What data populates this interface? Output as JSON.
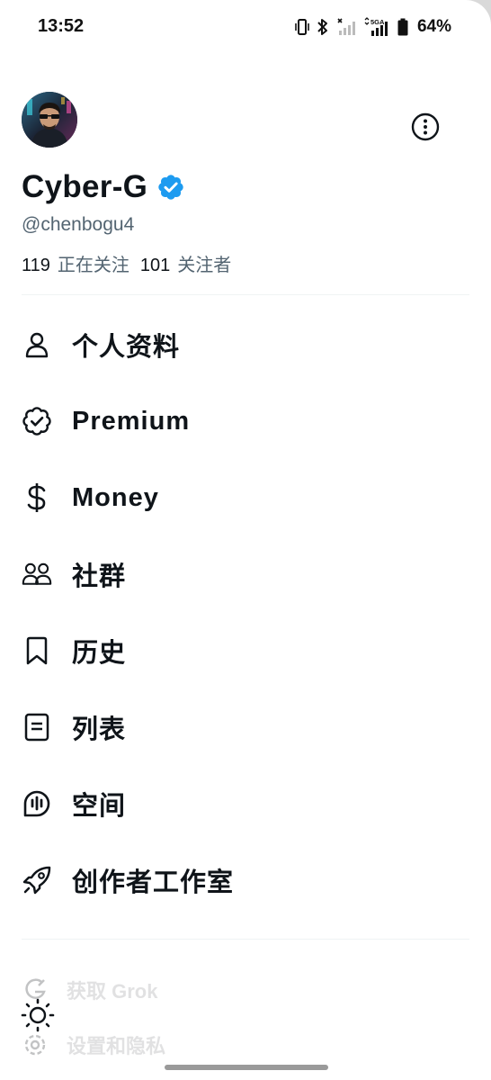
{
  "status_bar": {
    "time": "13:52",
    "battery": "64%",
    "network_label": "5GA"
  },
  "profile": {
    "display_name": "Cyber-G",
    "handle": "@chenbogu4",
    "following_count": "119",
    "following_label": "正在关注",
    "followers_count": "101",
    "followers_label": "关注者",
    "verified_color": "#1d9bf0"
  },
  "menu": {
    "items": [
      {
        "label": "个人资料",
        "icon": "person-icon"
      },
      {
        "label": "Premium",
        "icon": "verified-badge-icon"
      },
      {
        "label": "Money",
        "icon": "dollar-icon"
      },
      {
        "label": "社群",
        "icon": "communities-icon"
      },
      {
        "label": "历史",
        "icon": "bookmark-icon"
      },
      {
        "label": "列表",
        "icon": "lists-icon"
      },
      {
        "label": "空间",
        "icon": "spaces-icon"
      },
      {
        "label": "创作者工作室",
        "icon": "rocket-icon"
      }
    ]
  },
  "secondary": {
    "grok_label": "获取 Grok",
    "settings_label": "设置和隐私"
  },
  "colors": {
    "text_primary": "#0f1419",
    "text_secondary": "#536471",
    "accent": "#1d9bf0"
  }
}
